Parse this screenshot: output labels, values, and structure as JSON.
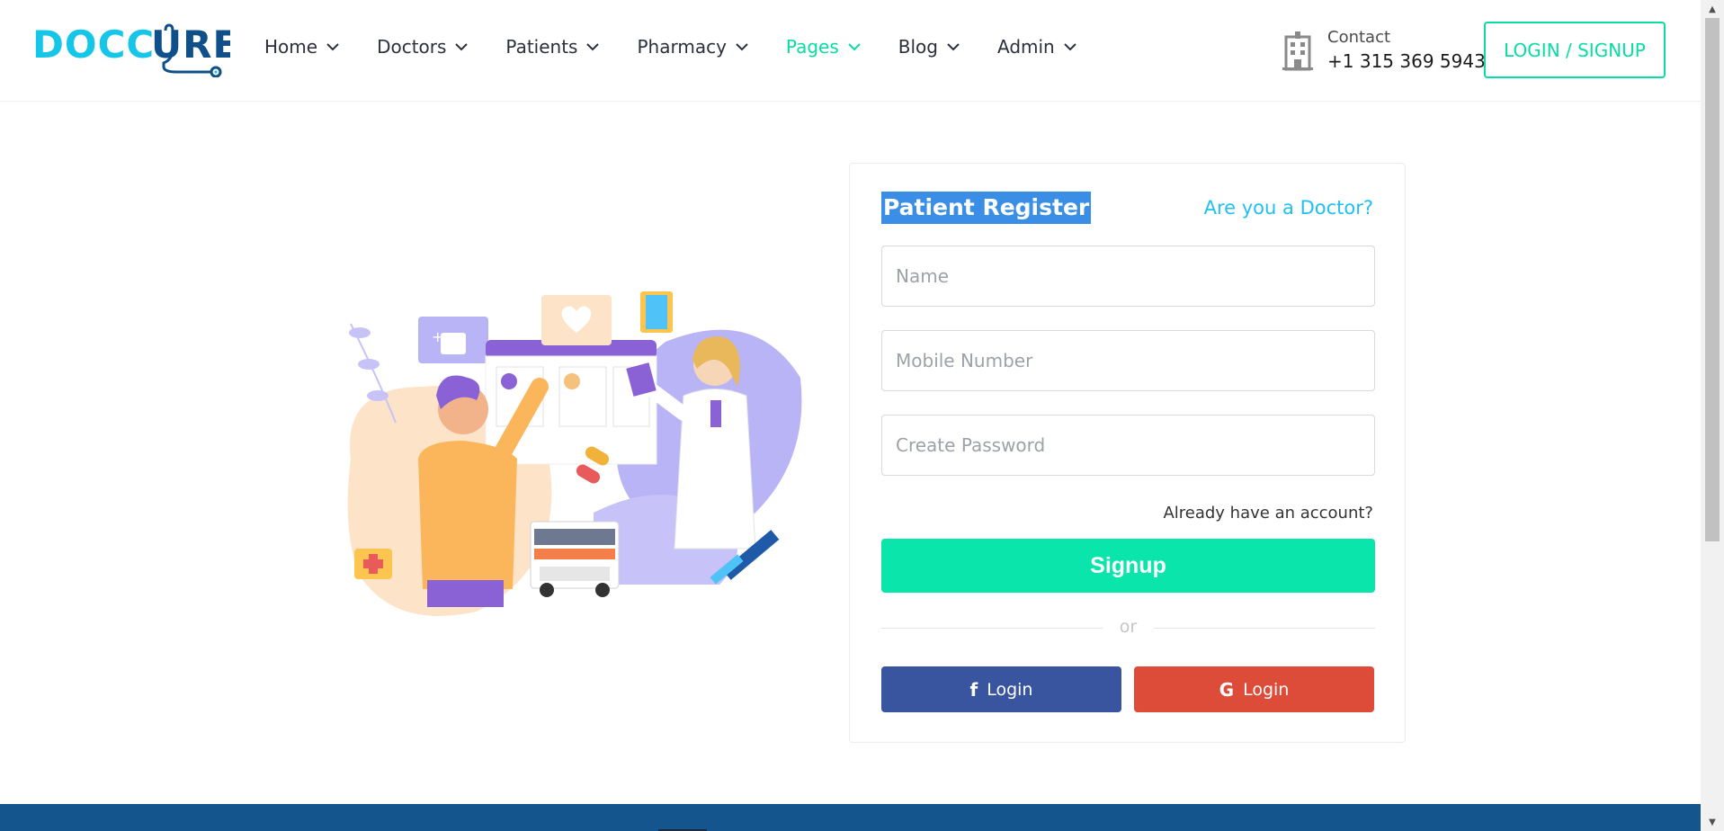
{
  "header": {
    "logo_text": "DOCCURE",
    "nav": [
      {
        "label": "Home",
        "active": false
      },
      {
        "label": "Doctors",
        "active": false
      },
      {
        "label": "Patients",
        "active": false
      },
      {
        "label": "Pharmacy",
        "active": false
      },
      {
        "label": "Pages",
        "active": true
      },
      {
        "label": "Blog",
        "active": false
      },
      {
        "label": "Admin",
        "active": false
      }
    ],
    "contact_label": "Contact",
    "contact_phone": "+1 315 369 5943",
    "login_signup": "LOGIN / SIGNUP"
  },
  "register": {
    "title": "Patient Register",
    "doctor_link": "Are you a Doctor?",
    "name_placeholder": "Name",
    "mobile_placeholder": "Mobile Number",
    "password_placeholder": "Create Password",
    "already_account": "Already have an account?",
    "signup_label": "Signup",
    "or_text": "or",
    "facebook_login": "Login",
    "google_login": "Login"
  },
  "colors": {
    "accent": "#09e5ab",
    "link": "#20c0f3",
    "facebook": "#3a559f",
    "google": "#dd4b39",
    "footer": "#15558d"
  },
  "icons": {
    "contact": "hospital-building-icon",
    "facebook": "facebook-icon",
    "google": "google-icon"
  }
}
